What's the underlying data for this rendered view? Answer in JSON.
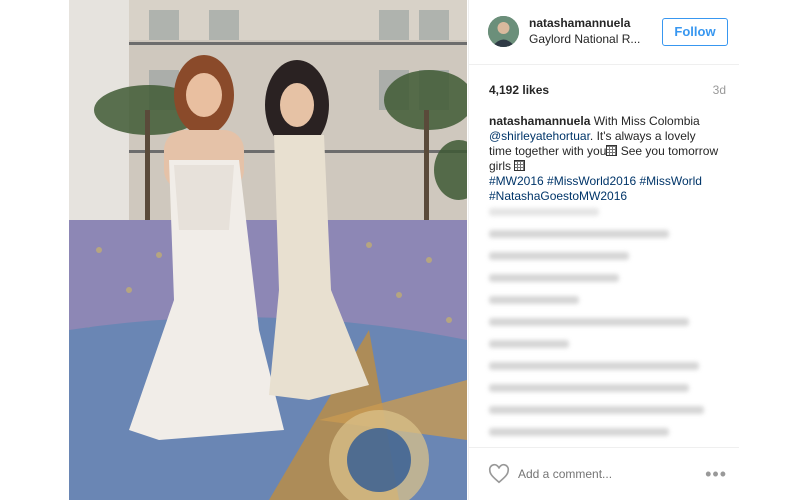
{
  "post": {
    "username": "natashamannuela",
    "location": "Gaylord National R...",
    "follow_label": "Follow",
    "likes": "4,192 likes",
    "age": "3d",
    "caption": {
      "username": "natashamannuela",
      "text_1": " With Miss Colombia ",
      "mention": "@shirleyatehortuar",
      "text_2": ". It's always a lovely time together with you",
      "text_3": " See you tomorrow girls ",
      "hashtags": "#MW2016 #MissWorld2016 #MissWorld #NatashaGoestoMW2016"
    },
    "add_comment_placeholder": "Add a comment...",
    "more_label": "•••"
  },
  "icons": {
    "heart": "heart-icon",
    "more": "more-options-icon",
    "avatar": "avatar"
  },
  "colors": {
    "follow_blue": "#3897f0",
    "link": "#003569",
    "muted": "#999999"
  }
}
